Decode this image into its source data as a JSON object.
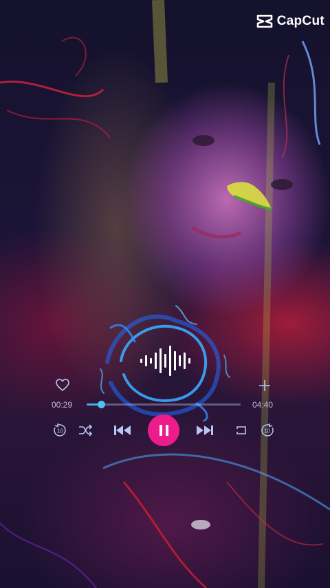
{
  "app": {
    "brand": "CapCut"
  },
  "player": {
    "current_time": "00:29",
    "total_time": "04:40",
    "progress_fraction": 0.094,
    "state": "playing"
  },
  "icons": {
    "brand": "capcut-logo-icon",
    "favorite": "heart-icon",
    "add": "plus-icon",
    "rewind": "replay-10-icon",
    "shuffle": "shuffle-icon",
    "previous": "skip-previous-icon",
    "pause": "pause-icon",
    "next": "skip-next-icon",
    "repeat": "repeat-icon",
    "forward": "forward-10-icon",
    "visualizer": "audio-waveform-icon"
  },
  "colors": {
    "accent_pink": "#ec1c8c",
    "accent_blue": "#3fb0e8",
    "controls": "#b8c6f4"
  }
}
